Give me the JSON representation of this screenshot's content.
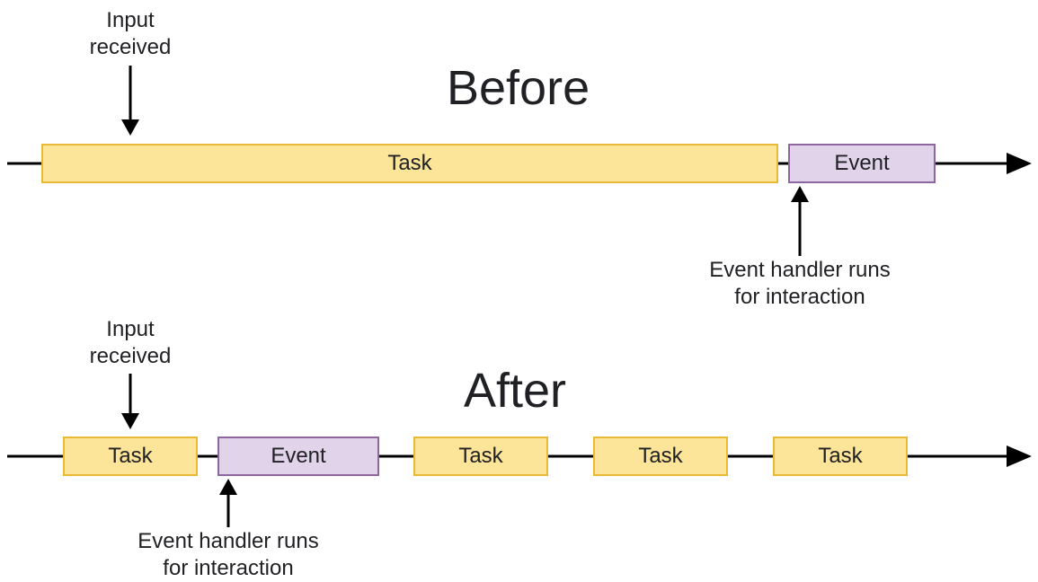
{
  "titles": {
    "before": "Before",
    "after": "After"
  },
  "labels": {
    "input_received": "Input\nreceived",
    "event_handler": "Event handler\nruns for interaction"
  },
  "blocks": {
    "task": "Task",
    "event": "Event"
  },
  "chart_data": {
    "type": "timeline-diagram",
    "description": "Two horizontal timelines comparing task scheduling before and after breaking up a long task.",
    "before": {
      "title": "Before",
      "annotations": [
        {
          "text": "Input received",
          "target_index": 0,
          "direction": "down",
          "position_in_block": "start"
        },
        {
          "text": "Event handler runs for interaction",
          "target_index": 1,
          "direction": "up",
          "position_in_block": "start"
        }
      ],
      "segments": [
        {
          "kind": "task",
          "label": "Task",
          "relative_width": 820
        },
        {
          "kind": "event",
          "label": "Event",
          "relative_width": 164
        }
      ]
    },
    "after": {
      "title": "After",
      "annotations": [
        {
          "text": "Input received",
          "target_index": 0,
          "direction": "down",
          "position_in_block": "center"
        },
        {
          "text": "Event handler runs for interaction",
          "target_index": 1,
          "direction": "up",
          "position_in_block": "start"
        }
      ],
      "segments": [
        {
          "kind": "task",
          "label": "Task",
          "relative_width": 150
        },
        {
          "kind": "event",
          "label": "Event",
          "relative_width": 180
        },
        {
          "kind": "task",
          "label": "Task",
          "relative_width": 150
        },
        {
          "kind": "task",
          "label": "Task",
          "relative_width": 150
        },
        {
          "kind": "task",
          "label": "Task",
          "relative_width": 150
        }
      ]
    }
  }
}
